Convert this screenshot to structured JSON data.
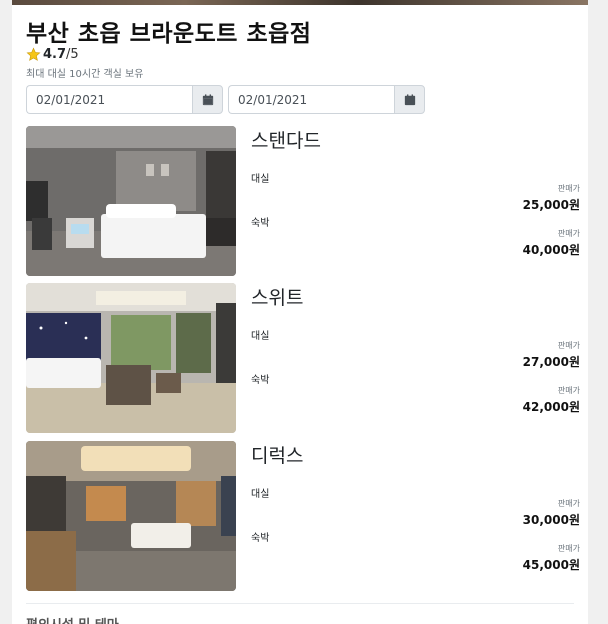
{
  "hotel": {
    "name": "부산 초읍 브라운도트 초읍점",
    "rating": "4.7",
    "rating_max": "/5",
    "notice": "최대 대실 10시간 객실 보유"
  },
  "dates": {
    "checkin": "02/01/2021",
    "checkout": "02/01/2021"
  },
  "rooms": [
    {
      "name": "스탠다드",
      "stays": [
        {
          "type": "대실",
          "price_label": "판매가",
          "price": "25,000원"
        },
        {
          "type": "숙박",
          "price_label": "판매가",
          "price": "40,000원"
        }
      ]
    },
    {
      "name": "스위트",
      "stays": [
        {
          "type": "대실",
          "price_label": "판매가",
          "price": "27,000원"
        },
        {
          "type": "숙박",
          "price_label": "판매가",
          "price": "42,000원"
        }
      ]
    },
    {
      "name": "디럭스",
      "stays": [
        {
          "type": "대실",
          "price_label": "판매가",
          "price": "30,000원"
        },
        {
          "type": "숙박",
          "price_label": "판매가",
          "price": "45,000원"
        }
      ]
    }
  ],
  "section": {
    "title": "편의시설 및 테마"
  },
  "colors": {
    "star": "#f5c518",
    "addon_bg": "#e9ecef",
    "muted_text": "#6c757d"
  },
  "icons": {
    "rating": "star-icon",
    "date_picker": "calendar-icon"
  }
}
